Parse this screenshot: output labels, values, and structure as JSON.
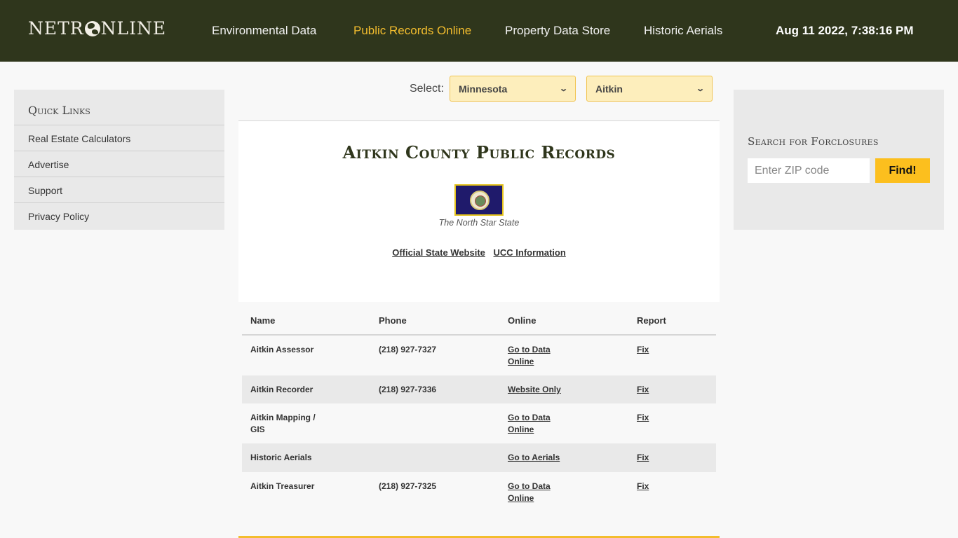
{
  "header": {
    "logo_left": "NETR",
    "logo_right": "NLINE",
    "nav": [
      {
        "label": "Environmental Data",
        "active": false
      },
      {
        "label": "Public Records Online",
        "active": true
      },
      {
        "label": "Property Data Store",
        "active": false
      },
      {
        "label": "Historic Aerials",
        "active": false
      }
    ],
    "datetime": "Aug 11 2022, 7:38:16 PM"
  },
  "quick_links": {
    "title": "Quick Links",
    "items": [
      {
        "label": "Real Estate Calculators"
      },
      {
        "label": "Advertise"
      },
      {
        "label": "Support"
      },
      {
        "label": "Privacy Policy"
      }
    ]
  },
  "selector": {
    "label": "Select:",
    "state": "Minnesota",
    "county": "Aitkin"
  },
  "county": {
    "title": "Aitkin County Public Records",
    "nickname": "The North Star State",
    "links": [
      {
        "label": "Official State Website"
      },
      {
        "label": "UCC Information"
      }
    ]
  },
  "table": {
    "headers": [
      "Name",
      "Phone",
      "Online",
      "Report"
    ],
    "rows": [
      {
        "name": "Aitkin Assessor",
        "phone": "(218) 927-7327",
        "online": "Go to Data Online",
        "report": "Fix"
      },
      {
        "name": "Aitkin Recorder",
        "phone": "(218) 927-7336",
        "online": "Website Only",
        "report": "Fix"
      },
      {
        "name": "Aitkin Mapping / GIS",
        "phone": "",
        "online": "Go to Data Online",
        "report": "Fix"
      },
      {
        "name": "Historic Aerials",
        "phone": "",
        "online": "Go to Aerials",
        "report": "Fix"
      },
      {
        "name": "Aitkin Treasurer",
        "phone": "(218) 927-7325",
        "online": "Go to Data Online",
        "report": "Fix"
      }
    ]
  },
  "foreclosure": {
    "title": "Search for Forclosures",
    "placeholder": "Enter ZIP code",
    "value": "",
    "button": "Find!"
  },
  "colors": {
    "header_bg": "#2f361c",
    "accent": "#f3bd2e",
    "button": "#fcbf1e",
    "select_bg": "#fdeebc"
  }
}
